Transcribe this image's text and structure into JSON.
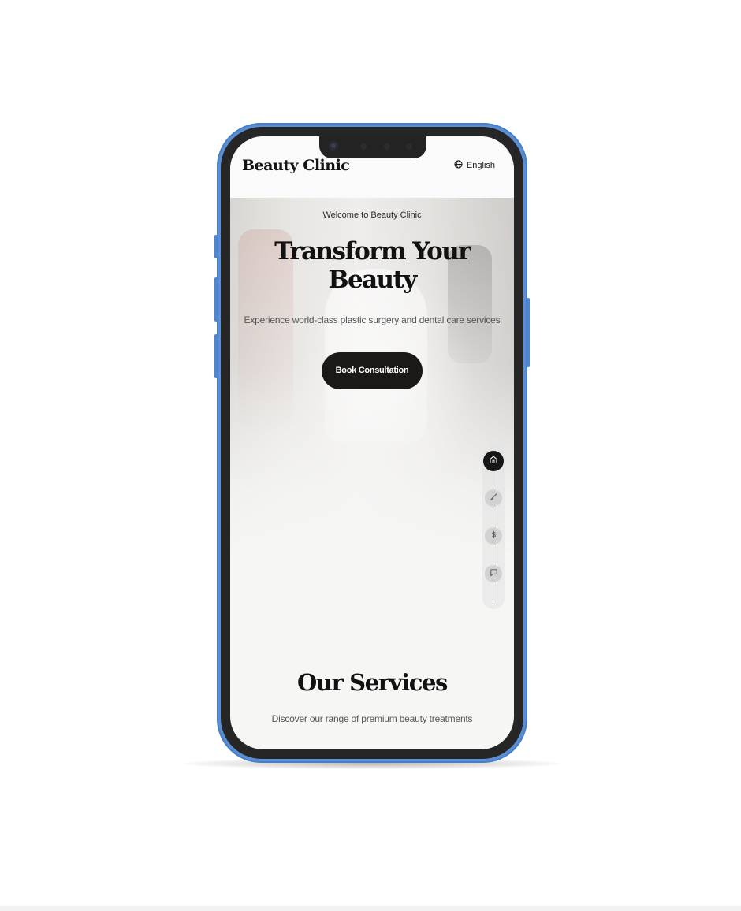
{
  "header": {
    "logo": "Beauty Clinic",
    "language": "English",
    "icons": {
      "language": "globe-icon"
    }
  },
  "hero": {
    "welcome": "Welcome to Beauty Clinic",
    "title": "Transform Your Beauty",
    "subtitle": "Experience world-class plastic surgery and dental care services",
    "cta_label": "Book Consultation"
  },
  "side_nav": {
    "items": [
      {
        "icon": "home-icon",
        "active": true
      },
      {
        "icon": "brush-icon",
        "active": false
      },
      {
        "icon": "dollar-icon",
        "active": false
      },
      {
        "icon": "message-icon",
        "active": false
      }
    ]
  },
  "services": {
    "title": "Our Services",
    "subtitle": "Discover our range of premium beauty treatments"
  },
  "colors": {
    "phone_frame": "#5a8fd6",
    "bezel": "#262626",
    "screen_bg": "#f6f6f5",
    "cta_bg": "#1b1918",
    "text_primary": "#111111",
    "text_secondary": "#555555"
  }
}
